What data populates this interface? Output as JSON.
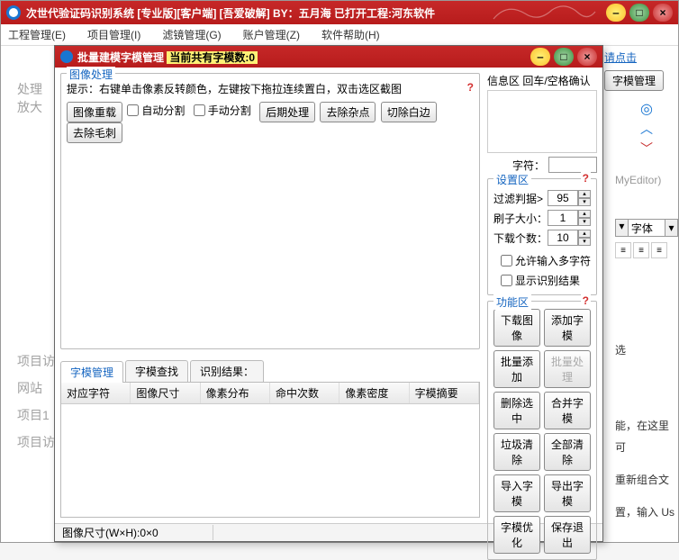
{
  "main": {
    "title": "次世代验证码识别系统 [专业版][客户端] [吾爱破解]  BY：五月海 已打开工程:河东软件",
    "menu": {
      "m1": "工程管理(E)",
      "m2": "项目管理(I)",
      "m3": "滤镜管理(G)",
      "m4": "账户管理(Z)",
      "m5": "软件帮助(H)"
    },
    "click": "请点击",
    "font_model_btn": "字模管理",
    "font_label": "字体",
    "myeditor": "MyEditor)",
    "right_text": {
      "t1": "选",
      "t2": "能，在这里可",
      "t3": "重新组合文",
      "t4": "置，输入 Us"
    },
    "bg": {
      "l1": "处理",
      "l2": "放大",
      "l3": "项目访",
      "l4": "网站",
      "l5": "项目1",
      "l6": "项目访"
    }
  },
  "dialog": {
    "title": "批量建模字模管理",
    "count_label": "当前共有字模数:0",
    "imgproc": {
      "title": "图像处理",
      "hint": "提示：右键单击像素反转颜色，左键按下拖拉连续置白，双击选区截图",
      "reload": "图像重载",
      "auto_split": "自动分割",
      "manual_split": "手动分割",
      "post": "后期处理",
      "denoise": "去除杂点",
      "trim": "切除白边",
      "deburr": "去除毛刺"
    },
    "tabs": {
      "t1": "字模管理",
      "t2": "字模查找",
      "t3": "识别结果："
    },
    "columns": {
      "c1": "对应字符",
      "c2": "图像尺寸",
      "c3": "像素分布",
      "c4": "命中次数",
      "c5": "像素密度",
      "c6": "字模摘要"
    },
    "info": {
      "title": "信息区  回车/空格确认",
      "char_label": "字符："
    },
    "settings": {
      "title": "设置区",
      "filter": "过滤判据>",
      "filter_v": "95",
      "brush": "刷子大小：",
      "brush_v": "1",
      "count": "下载个数：",
      "count_v": "10",
      "multi": "允许输入多字符",
      "show": "显示识别结果"
    },
    "fn": {
      "title": "功能区",
      "b1": "下载图像",
      "b2": "添加字模",
      "b3": "批量添加",
      "b4": "批量处理",
      "b5": "删除选中",
      "b6": "合并字模",
      "b7": "垃圾清除",
      "b8": "全部清除",
      "b9": "导入字模",
      "b10": "导出字模",
      "b11": "字模优化",
      "b12": "保存退出"
    },
    "status": "图像尺寸(W×H):0×0"
  }
}
